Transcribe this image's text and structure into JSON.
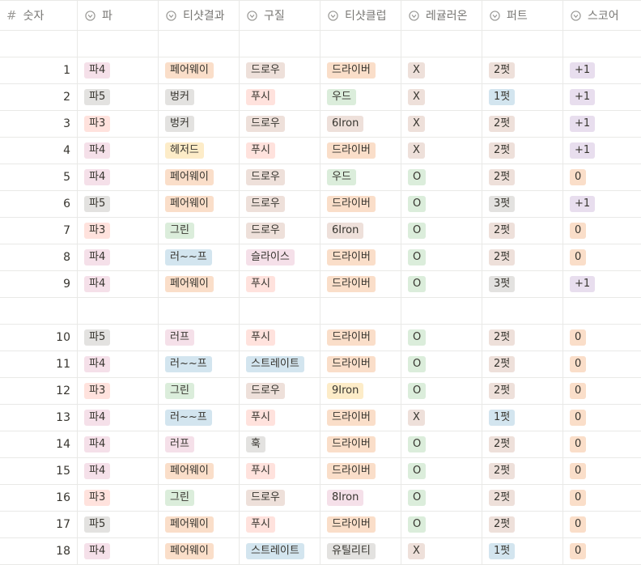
{
  "columns": [
    {
      "label": "숫자",
      "icon": "number-icon"
    },
    {
      "label": "파",
      "icon": "select-icon"
    },
    {
      "label": "티샷결과",
      "icon": "select-icon"
    },
    {
      "label": "구질",
      "icon": "select-icon"
    },
    {
      "label": "티샷클럽",
      "icon": "select-icon"
    },
    {
      "label": "레귤러온",
      "icon": "select-icon"
    },
    {
      "label": "퍼트",
      "icon": "select-icon"
    },
    {
      "label": "스코어",
      "icon": "select-icon"
    }
  ],
  "colors": {
    "pink": "#f5e0e9",
    "gray": "#e3e2e0",
    "red": "#ffe2dd",
    "orange": "#fadec9",
    "brown": "#eee0da",
    "yellow": "#fdecc8",
    "green": "#dbeddb",
    "blue": "#d3e5ef",
    "purple": "#e8deee"
  },
  "rows": [
    {
      "empty": true
    },
    {
      "n": "1",
      "par": [
        "파4",
        "pink"
      ],
      "tee": [
        "페어웨이",
        "orange"
      ],
      "shot": [
        "드로우",
        "brown"
      ],
      "club": [
        "드라이버",
        "orange"
      ],
      "gir": [
        "X",
        "brown"
      ],
      "putt": [
        "2펏",
        "brown"
      ],
      "score": [
        "+1",
        "purple"
      ]
    },
    {
      "n": "2",
      "par": [
        "파5",
        "gray"
      ],
      "tee": [
        "벙커",
        "gray"
      ],
      "shot": [
        "푸시",
        "red"
      ],
      "club": [
        "우드",
        "green"
      ],
      "gir": [
        "X",
        "brown"
      ],
      "putt": [
        "1펏",
        "blue"
      ],
      "score": [
        "+1",
        "purple"
      ]
    },
    {
      "n": "3",
      "par": [
        "파3",
        "red"
      ],
      "tee": [
        "벙커",
        "gray"
      ],
      "shot": [
        "드로우",
        "brown"
      ],
      "club": [
        "6Iron",
        "brown"
      ],
      "gir": [
        "X",
        "brown"
      ],
      "putt": [
        "2펏",
        "brown"
      ],
      "score": [
        "+1",
        "purple"
      ]
    },
    {
      "n": "4",
      "par": [
        "파4",
        "pink"
      ],
      "tee": [
        "헤저드",
        "yellow"
      ],
      "shot": [
        "푸시",
        "red"
      ],
      "club": [
        "드라이버",
        "orange"
      ],
      "gir": [
        "X",
        "brown"
      ],
      "putt": [
        "2펏",
        "brown"
      ],
      "score": [
        "+1",
        "purple"
      ]
    },
    {
      "n": "5",
      "par": [
        "파4",
        "pink"
      ],
      "tee": [
        "페어웨이",
        "orange"
      ],
      "shot": [
        "드로우",
        "brown"
      ],
      "club": [
        "우드",
        "green"
      ],
      "gir": [
        "O",
        "green"
      ],
      "putt": [
        "2펏",
        "brown"
      ],
      "score": [
        "0",
        "orange"
      ]
    },
    {
      "n": "6",
      "par": [
        "파5",
        "gray"
      ],
      "tee": [
        "페어웨이",
        "orange"
      ],
      "shot": [
        "드로우",
        "brown"
      ],
      "club": [
        "드라이버",
        "orange"
      ],
      "gir": [
        "O",
        "green"
      ],
      "putt": [
        "3펏",
        "gray"
      ],
      "score": [
        "+1",
        "purple"
      ]
    },
    {
      "n": "7",
      "par": [
        "파3",
        "red"
      ],
      "tee": [
        "그린",
        "green"
      ],
      "shot": [
        "드로우",
        "brown"
      ],
      "club": [
        "6Iron",
        "brown"
      ],
      "gir": [
        "O",
        "green"
      ],
      "putt": [
        "2펏",
        "brown"
      ],
      "score": [
        "0",
        "orange"
      ]
    },
    {
      "n": "8",
      "par": [
        "파4",
        "pink"
      ],
      "tee": [
        "러~~프",
        "blue"
      ],
      "shot": [
        "슬라이스",
        "pink"
      ],
      "club": [
        "드라이버",
        "orange"
      ],
      "gir": [
        "O",
        "green"
      ],
      "putt": [
        "2펏",
        "brown"
      ],
      "score": [
        "0",
        "orange"
      ]
    },
    {
      "n": "9",
      "par": [
        "파4",
        "pink"
      ],
      "tee": [
        "페어웨이",
        "orange"
      ],
      "shot": [
        "푸시",
        "red"
      ],
      "club": [
        "드라이버",
        "orange"
      ],
      "gir": [
        "O",
        "green"
      ],
      "putt": [
        "3펏",
        "gray"
      ],
      "score": [
        "+1",
        "purple"
      ]
    },
    {
      "empty": true
    },
    {
      "n": "10",
      "par": [
        "파5",
        "gray"
      ],
      "tee": [
        "러프",
        "pink"
      ],
      "shot": [
        "푸시",
        "red"
      ],
      "club": [
        "드라이버",
        "orange"
      ],
      "gir": [
        "O",
        "green"
      ],
      "putt": [
        "2펏",
        "brown"
      ],
      "score": [
        "0",
        "orange"
      ]
    },
    {
      "n": "11",
      "par": [
        "파4",
        "pink"
      ],
      "tee": [
        "러~~프",
        "blue"
      ],
      "shot": [
        "스트레이트",
        "blue"
      ],
      "club": [
        "드라이버",
        "orange"
      ],
      "gir": [
        "O",
        "green"
      ],
      "putt": [
        "2펏",
        "brown"
      ],
      "score": [
        "0",
        "orange"
      ]
    },
    {
      "n": "12",
      "par": [
        "파3",
        "red"
      ],
      "tee": [
        "그린",
        "green"
      ],
      "shot": [
        "드로우",
        "brown"
      ],
      "club": [
        "9Iron",
        "yellow"
      ],
      "gir": [
        "O",
        "green"
      ],
      "putt": [
        "2펏",
        "brown"
      ],
      "score": [
        "0",
        "orange"
      ]
    },
    {
      "n": "13",
      "par": [
        "파4",
        "pink"
      ],
      "tee": [
        "러~~프",
        "blue"
      ],
      "shot": [
        "푸시",
        "red"
      ],
      "club": [
        "드라이버",
        "orange"
      ],
      "gir": [
        "X",
        "brown"
      ],
      "putt": [
        "1펏",
        "blue"
      ],
      "score": [
        "0",
        "orange"
      ]
    },
    {
      "n": "14",
      "par": [
        "파4",
        "pink"
      ],
      "tee": [
        "러프",
        "pink"
      ],
      "shot": [
        "훅",
        "gray"
      ],
      "club": [
        "드라이버",
        "orange"
      ],
      "gir": [
        "O",
        "green"
      ],
      "putt": [
        "2펏",
        "brown"
      ],
      "score": [
        "0",
        "orange"
      ]
    },
    {
      "n": "15",
      "par": [
        "파4",
        "pink"
      ],
      "tee": [
        "페어웨이",
        "orange"
      ],
      "shot": [
        "푸시",
        "red"
      ],
      "club": [
        "드라이버",
        "orange"
      ],
      "gir": [
        "O",
        "green"
      ],
      "putt": [
        "2펏",
        "brown"
      ],
      "score": [
        "0",
        "orange"
      ]
    },
    {
      "n": "16",
      "par": [
        "파3",
        "red"
      ],
      "tee": [
        "그린",
        "green"
      ],
      "shot": [
        "드로우",
        "brown"
      ],
      "club": [
        "8Iron",
        "pink"
      ],
      "gir": [
        "O",
        "green"
      ],
      "putt": [
        "2펏",
        "brown"
      ],
      "score": [
        "0",
        "orange"
      ]
    },
    {
      "n": "17",
      "par": [
        "파5",
        "gray"
      ],
      "tee": [
        "페어웨이",
        "orange"
      ],
      "shot": [
        "푸시",
        "red"
      ],
      "club": [
        "드라이버",
        "orange"
      ],
      "gir": [
        "O",
        "green"
      ],
      "putt": [
        "2펏",
        "brown"
      ],
      "score": [
        "0",
        "orange"
      ]
    },
    {
      "n": "18",
      "par": [
        "파4",
        "pink"
      ],
      "tee": [
        "페어웨이",
        "orange"
      ],
      "shot": [
        "스트레이트",
        "blue"
      ],
      "club": [
        "유틸리티",
        "gray"
      ],
      "gir": [
        "X",
        "brown"
      ],
      "putt": [
        "1펏",
        "blue"
      ],
      "score": [
        "0",
        "orange"
      ]
    }
  ]
}
